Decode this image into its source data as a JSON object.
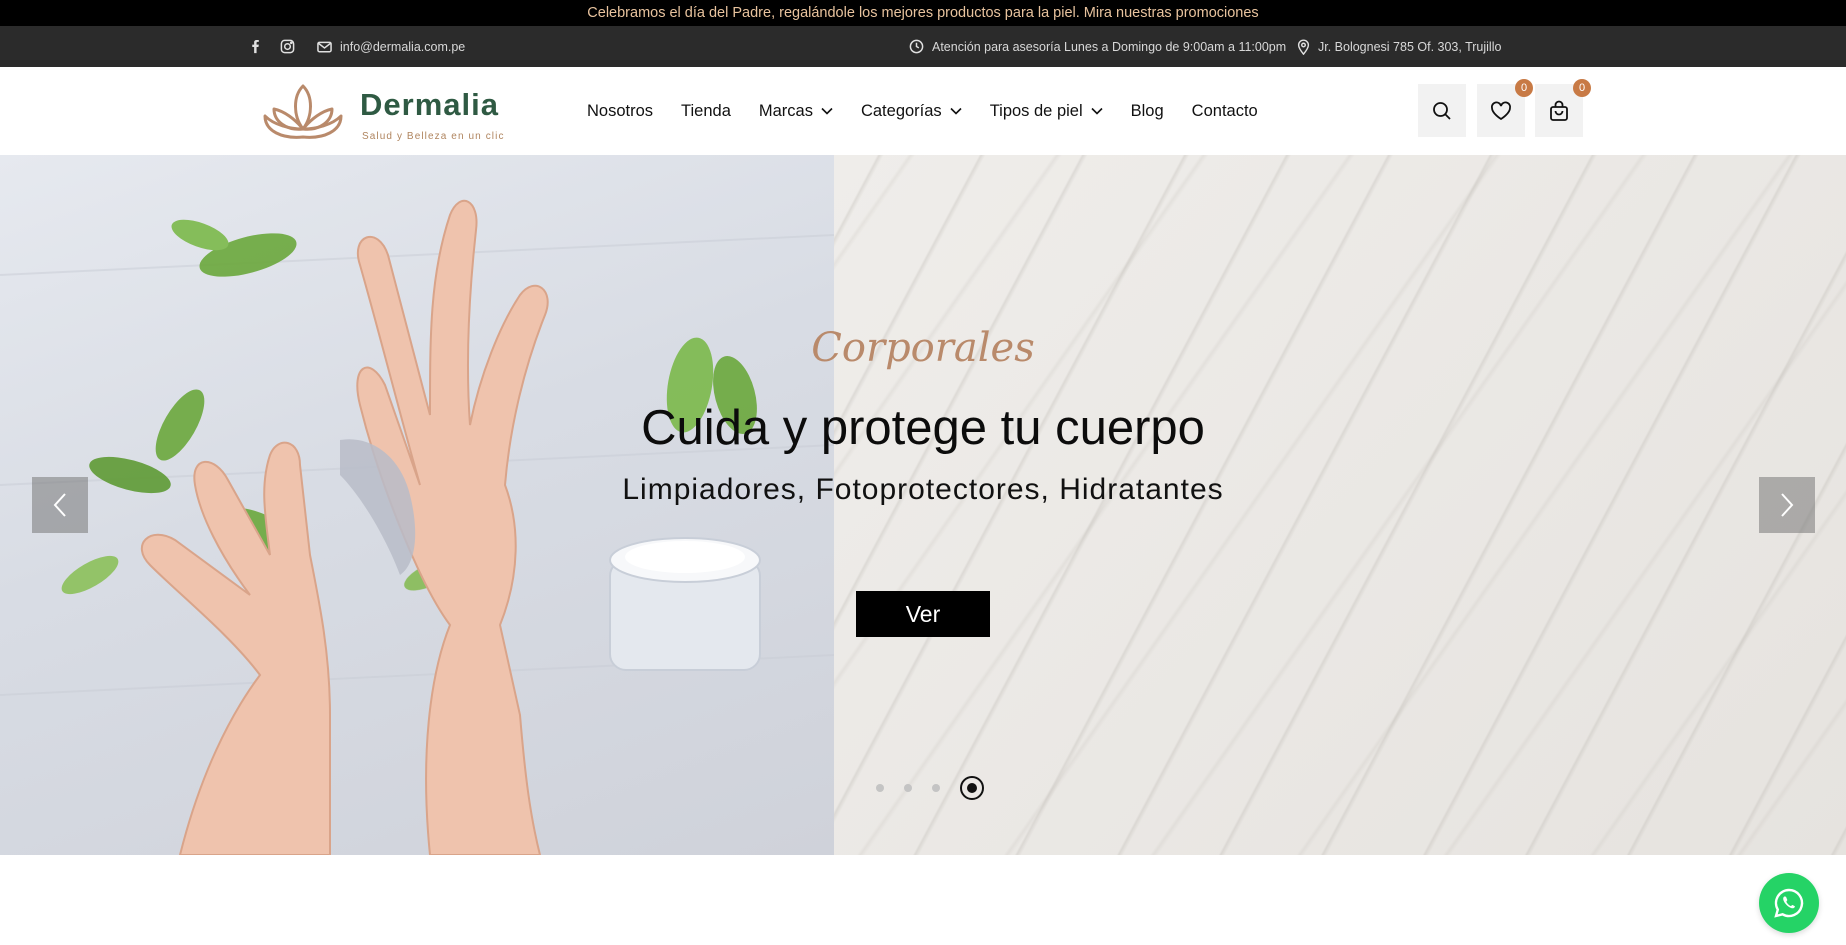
{
  "promo": {
    "text": "Celebramos el día del Padre, regalándole los mejores productos para la piel. Mira nuestras promociones"
  },
  "topbar": {
    "email": "info@dermalia.com.pe",
    "hours": "Atención para asesoría Lunes a Domingo de 9:00am a 11:00pm",
    "address": "Jr. Bolognesi 785 Of. 303, Trujillo",
    "social": [
      "facebook-icon",
      "instagram-icon"
    ]
  },
  "header": {
    "brand": "Dermalia",
    "tagline": "Salud y Belleza en un clic",
    "nav": [
      {
        "label": "Nosotros",
        "dropdown": false
      },
      {
        "label": "Tienda",
        "dropdown": false
      },
      {
        "label": "Marcas",
        "dropdown": true
      },
      {
        "label": "Categorías",
        "dropdown": true
      },
      {
        "label": "Tipos de piel",
        "dropdown": true
      },
      {
        "label": "Blog",
        "dropdown": false
      },
      {
        "label": "Contacto",
        "dropdown": false
      }
    ],
    "wishlist_count": "0",
    "cart_count": "0"
  },
  "hero": {
    "subtitle": "Corporales",
    "title": "Cuida y protege tu cuerpo",
    "description": "Limpiadores, Fotoprotectores, Hidratantes",
    "button": "Ver",
    "slide_count": 4,
    "active_slide": 4
  },
  "colors": {
    "promo_text": "#e8c39e",
    "brand_green": "#2f5a43",
    "accent": "#c87a45",
    "whatsapp": "#25d366"
  }
}
